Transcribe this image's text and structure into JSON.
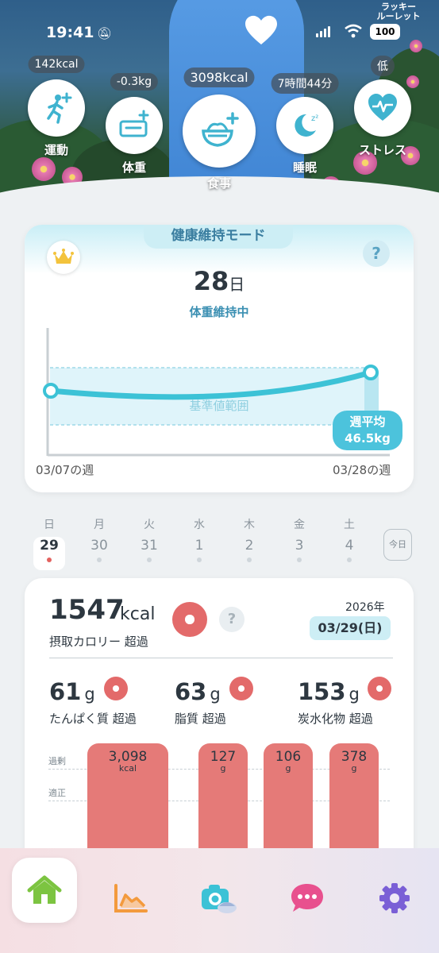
{
  "status_bar": {
    "time": "19:41",
    "battery": "100"
  },
  "lucky_roulette": "ラッキー\nルーレット",
  "metrics": [
    {
      "label": "運動",
      "value": "142kcal",
      "icon": "running-plus-icon"
    },
    {
      "label": "体重",
      "value": "-0.3kg",
      "icon": "scale-plus-icon"
    },
    {
      "label": "食事",
      "value": "3098kcal",
      "icon": "meal-plus-icon"
    },
    {
      "label": "睡眠",
      "value": "7時間44分",
      "icon": "moon-sleep-icon"
    },
    {
      "label": "ストレス",
      "value": "低",
      "icon": "heart-pulse-icon"
    }
  ],
  "health_card": {
    "mode": "健康維持モード",
    "days_value": "28",
    "days_unit": "日",
    "subtitle": "体重維持中",
    "range_label": "基準値範囲",
    "avg_label": "週平均",
    "avg_value": "46.5kg",
    "week_start": "03/07の週",
    "week_end": "03/28の週"
  },
  "days": [
    {
      "dow": "日",
      "date": "29",
      "selected": true
    },
    {
      "dow": "月",
      "date": "30"
    },
    {
      "dow": "火",
      "date": "31"
    },
    {
      "dow": "水",
      "date": "1"
    },
    {
      "dow": "木",
      "date": "2"
    },
    {
      "dow": "金",
      "date": "3"
    },
    {
      "dow": "土",
      "date": "4"
    }
  ],
  "today_button": "今日",
  "nutrition": {
    "kcal_value": "1547",
    "kcal_unit": "kcal",
    "kcal_label": "摂取カロリー 超過",
    "year": "2026年",
    "date": "03/29(日)",
    "macros": [
      {
        "value": "61",
        "unit": "g",
        "label": "たんぱく質 超過"
      },
      {
        "value": "63",
        "unit": "g",
        "label": "脂質 超過"
      },
      {
        "value": "153",
        "unit": "g",
        "label": "炭水化物 超過"
      }
    ],
    "ref_excess": "過剰",
    "ref_proper": "適正",
    "bars": [
      {
        "value": "3,098",
        "unit": "kcal"
      },
      {
        "value": "127",
        "unit": "g"
      },
      {
        "value": "106",
        "unit": "g"
      },
      {
        "value": "378",
        "unit": "g"
      }
    ]
  },
  "colors": {
    "accent": "#4cc3dc",
    "over": "#e36a6a",
    "bar": "#e57a78"
  },
  "nav": [
    {
      "name": "home",
      "icon": "home-icon",
      "active": true
    },
    {
      "name": "graph",
      "icon": "chart-icon"
    },
    {
      "name": "camera",
      "icon": "camera-meal-icon"
    },
    {
      "name": "chat",
      "icon": "chat-icon"
    },
    {
      "name": "settings",
      "icon": "gear-icon"
    }
  ]
}
